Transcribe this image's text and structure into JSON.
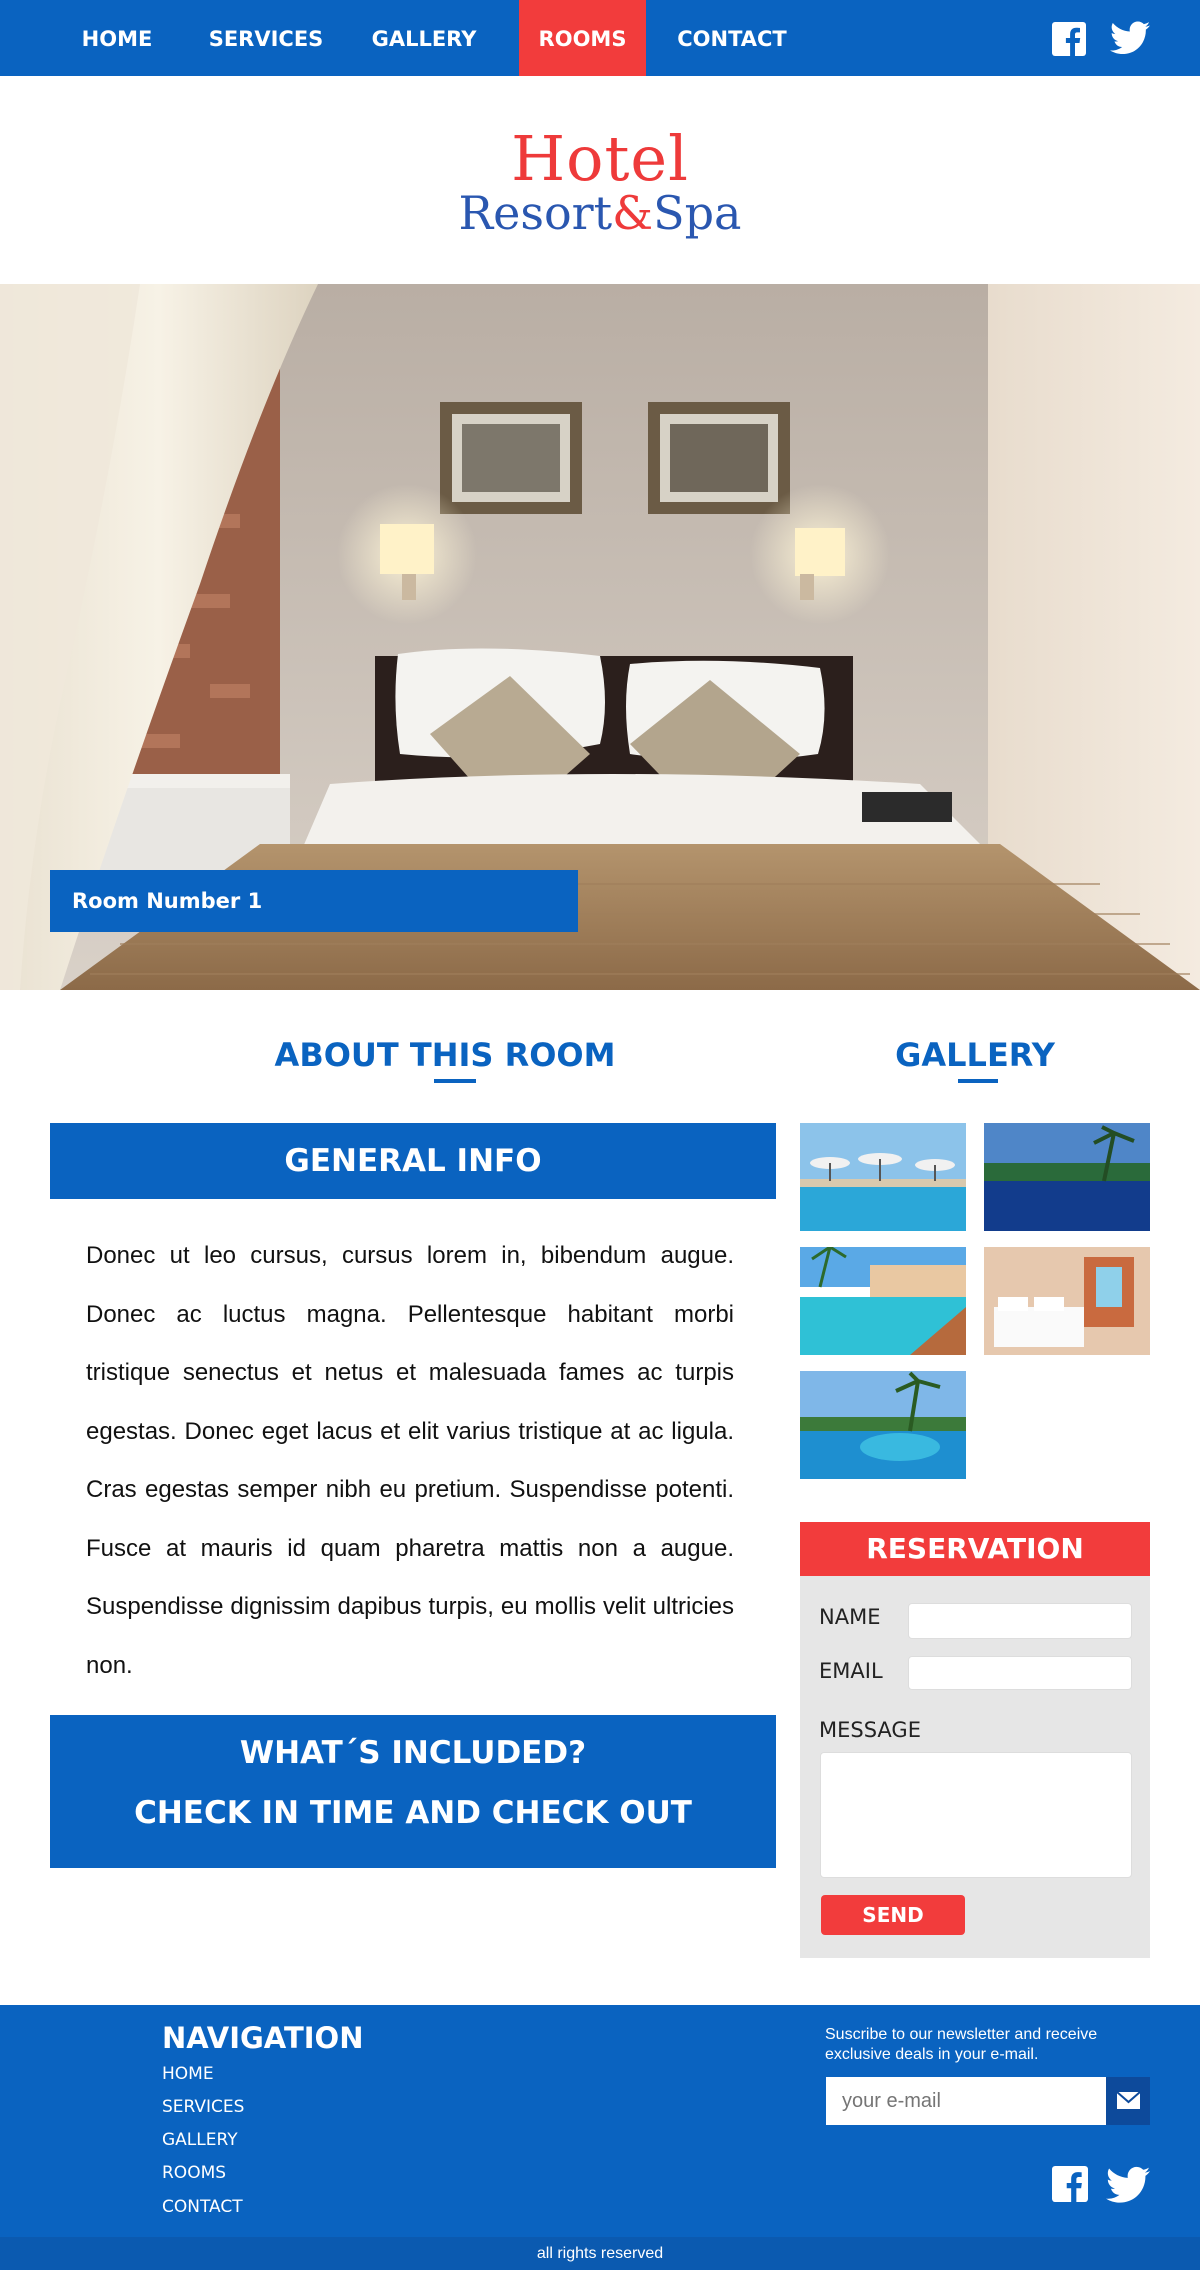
{
  "nav": {
    "items": [
      {
        "label": "HOME"
      },
      {
        "label": "SERVICES"
      },
      {
        "label": "GALLERY"
      },
      {
        "label": "ROOMS",
        "active": true
      },
      {
        "label": "CONTACT"
      }
    ],
    "social": [
      "facebook-icon",
      "twitter-icon"
    ]
  },
  "logo": {
    "line1": "Hotel",
    "resort": "Resort",
    "amp": "&",
    "spa": "Spa"
  },
  "hero": {
    "room_label": "Room Number 1"
  },
  "about": {
    "heading": "ABOUT THIS ROOM",
    "general_info": "GENERAL INFO",
    "body": "Donec ut leo cursus, cursus lorem in, bibendum augue. Donec ac luctus magna. Pellentesque habitant morbi tristique senectus et netus et malesuada fames ac turpis egestas. Donec eget lacus et elit varius tristique at ac ligula. Cras egestas semper nibh eu pretium. Suspendisse potenti. Fusce at mauris id quam pharetra mattis non a augue. Suspendisse dignissim dapibus turpis, eu mollis velit ultricies non.",
    "included_line1": "WHAT´S INCLUDED?",
    "included_line2": "CHECK IN TIME AND CHECK OUT"
  },
  "gallery": {
    "heading": "GALLERY",
    "thumbs": [
      "pool-umbrellas",
      "infinity-pool-palms",
      "resort-pool",
      "hotel-bedroom",
      "palm-pool"
    ]
  },
  "reservation": {
    "heading": "RESERVATION",
    "name_label": "NAME",
    "email_label": "EMAIL",
    "message_label": "MESSAGE",
    "send_label": "SEND"
  },
  "footer": {
    "nav_title": "NAVIGATION",
    "links": [
      "HOME",
      "SERVICES",
      "GALLERY",
      "ROOMS",
      "CONTACT"
    ],
    "newsletter_text": "Suscribe to our newsletter and receive exclusive deals in your e-mail.",
    "email_placeholder": "your e-mail",
    "rights": "all rights reserved"
  },
  "colors": {
    "primary": "#0a63c0",
    "accent": "#f23c3c",
    "panel": "#e6e6e6"
  }
}
